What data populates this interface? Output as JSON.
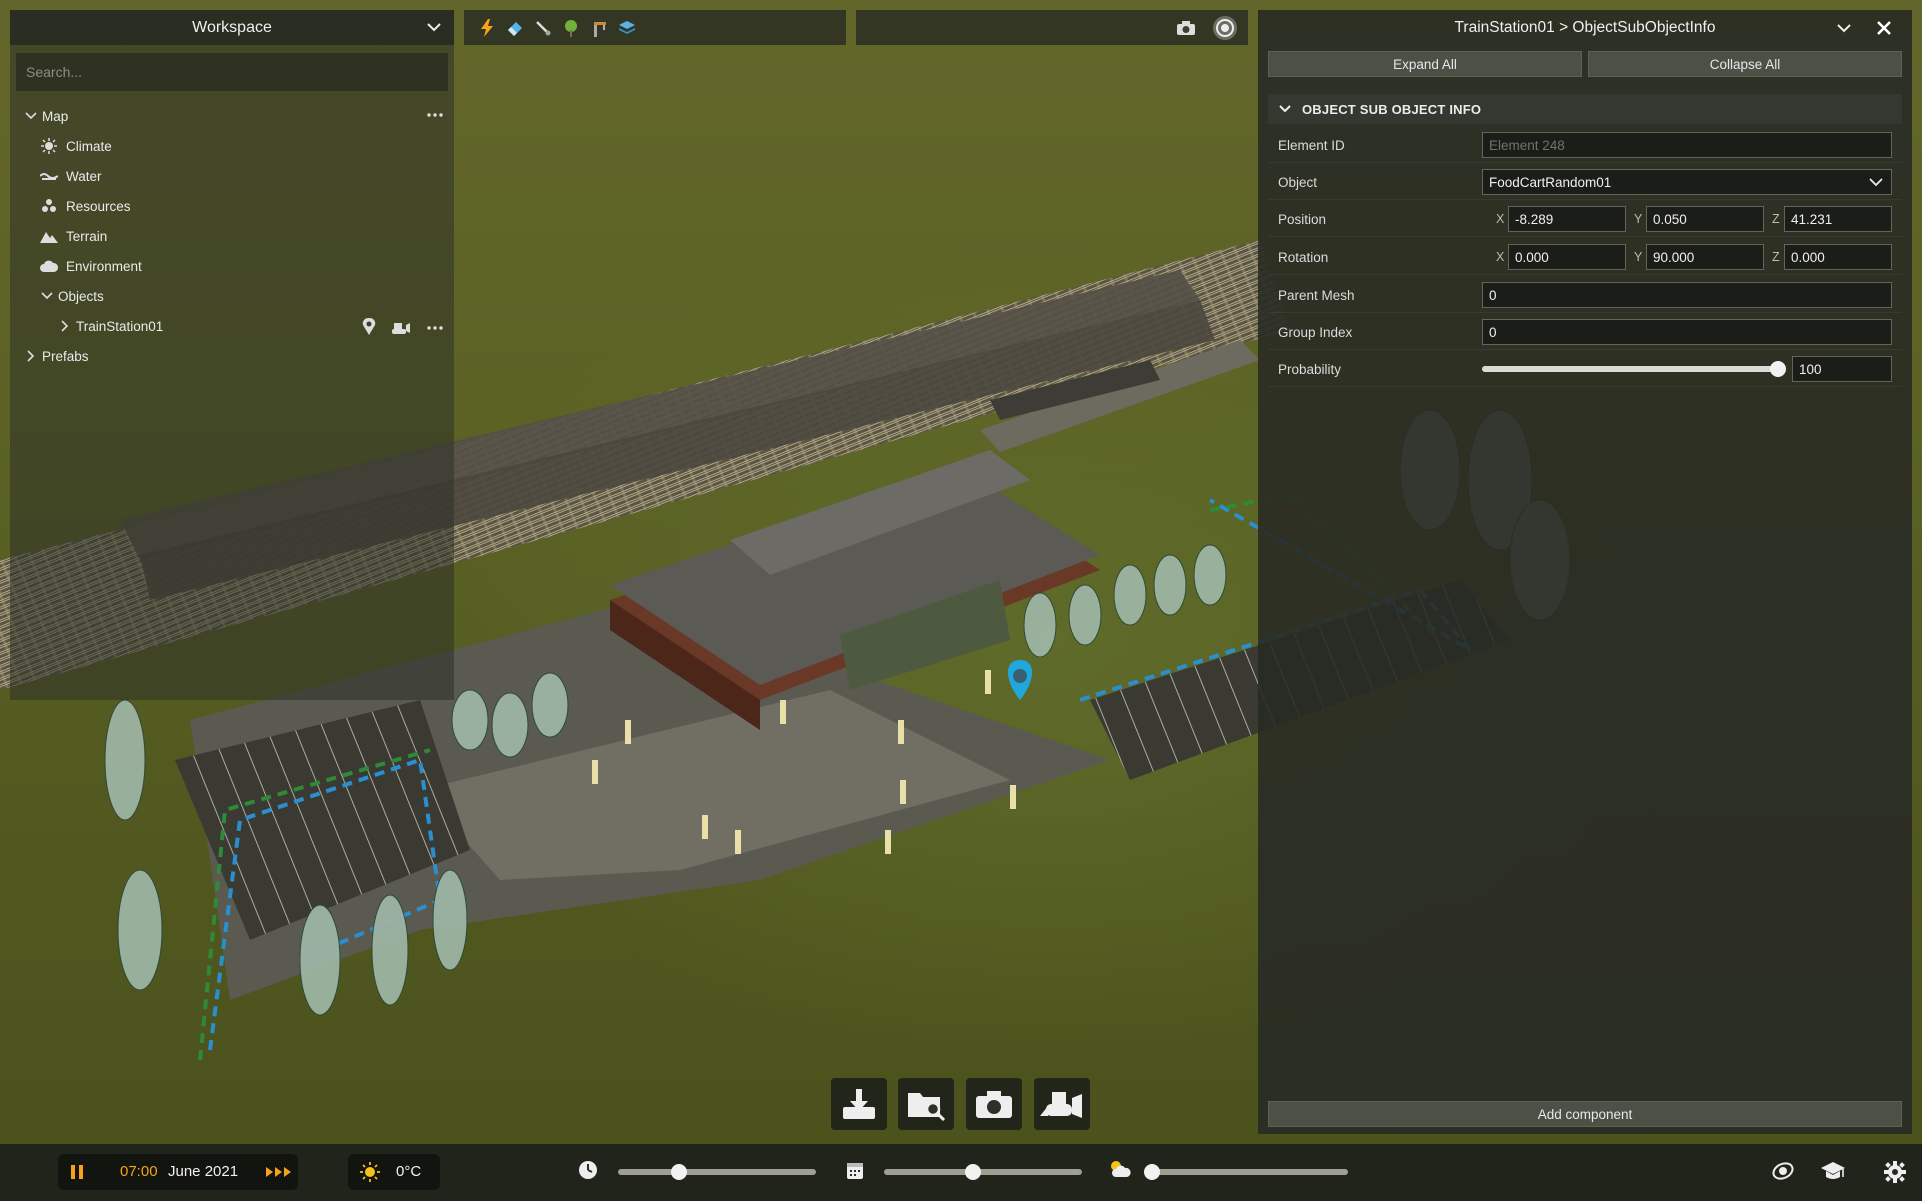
{
  "workspace": {
    "title": "Workspace",
    "search_placeholder": "Search...",
    "tree": {
      "map": "Map",
      "climate": "Climate",
      "water": "Water",
      "resources": "Resources",
      "terrain": "Terrain",
      "environment": "Environment",
      "objects": "Objects",
      "train_station": "TrainStation01",
      "prefabs": "Prefabs"
    }
  },
  "toolbar": {
    "icons": [
      "lightning-icon",
      "eraser-icon",
      "brush-icon",
      "tree-icon",
      "crane-icon",
      "layers-icon"
    ]
  },
  "inspector": {
    "title": "TrainStation01 > ObjectSubObjectInfo",
    "expand_all": "Expand All",
    "collapse_all": "Collapse All",
    "section": "OBJECT SUB OBJECT INFO",
    "element_id_label": "Element ID",
    "element_id_placeholder": "Element 248",
    "object_label": "Object",
    "object_value": "FoodCartRandom01",
    "position_label": "Position",
    "position": {
      "x": "-8.289",
      "y": "0.050",
      "z": "41.231"
    },
    "rotation_label": "Rotation",
    "rotation": {
      "x": "0.000",
      "y": "90.000",
      "z": "0.000"
    },
    "axis_x": "X",
    "axis_y": "Y",
    "axis_z": "Z",
    "parent_mesh_label": "Parent Mesh",
    "parent_mesh_value": "0",
    "group_index_label": "Group Index",
    "group_index_value": "0",
    "probability_label": "Probability",
    "probability_value": "100",
    "probability_level": 1.0,
    "add_component": "Add component"
  },
  "bottom": {
    "time": "07:00",
    "date": "June 2021",
    "temperature": "0°C",
    "time_slider_level": 0.31,
    "date_slider_level": 0.45,
    "weather_slider_level": 0.0
  },
  "colors": {
    "accent_orange": "#f6a21a",
    "marker_blue": "#1fa8e0",
    "panel_bg": "#2a2d26"
  }
}
